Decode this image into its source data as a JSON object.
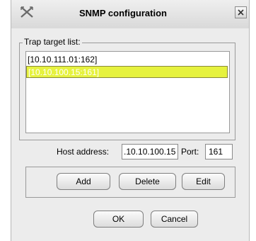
{
  "window": {
    "title": "SNMP configuration",
    "icon": "snmp-app-icon",
    "close_icon": "close-icon"
  },
  "trap_list": {
    "label": "Trap target list:",
    "items": [
      "[10.10.111.01:162]",
      "[10.10.100.15:161]"
    ],
    "selected_index": 1
  },
  "host": {
    "label": "Host address:",
    "value": ".10.10.100.15"
  },
  "port": {
    "label": "Port:",
    "value": "161"
  },
  "buttons": {
    "add": "Add",
    "delete": "Delete",
    "edit": "Edit",
    "ok": "OK",
    "cancel": "Cancel"
  },
  "colors": {
    "selection": "#e6f23e",
    "background": "#ececec"
  }
}
